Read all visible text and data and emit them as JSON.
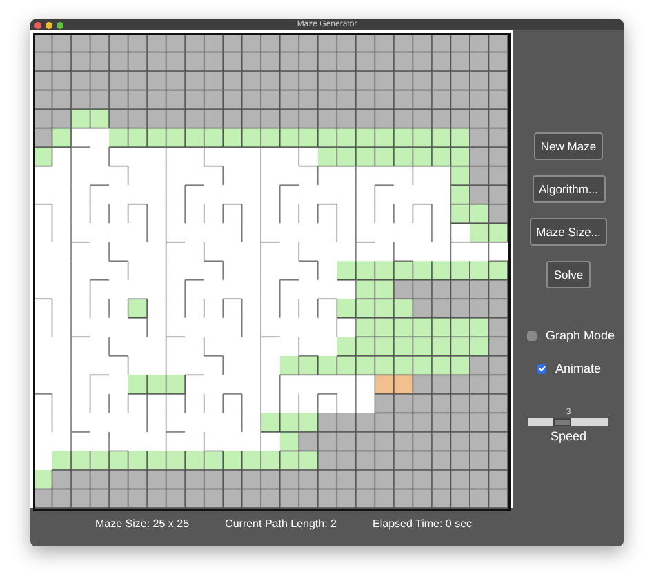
{
  "window": {
    "title": "Maze Generator"
  },
  "buttons": [
    "New Maze",
    "Algorithm...",
    "Maze Size...",
    "Solve"
  ],
  "options": [
    {
      "label": "Graph Mode",
      "checked": false
    },
    {
      "label": "Animate",
      "checked": true
    }
  ],
  "speed": {
    "value": "3",
    "level": 0.4,
    "label": "Speed"
  },
  "status_bar": [
    "Maze Size: 25 x 25",
    "Current Path Length: 2",
    "Elapsed Time: 0 sec"
  ]
}
